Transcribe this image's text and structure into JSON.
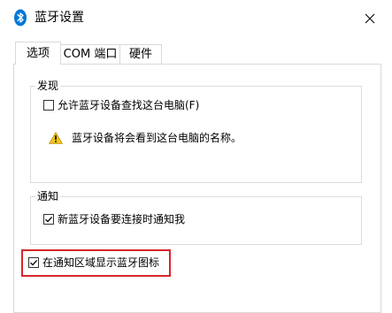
{
  "window": {
    "title": "蓝牙设置",
    "title_icon": "bluetooth-icon",
    "close_icon": "close-icon"
  },
  "tabs": [
    {
      "label": "选项",
      "active": true
    },
    {
      "label": "COM 端口",
      "active": false
    },
    {
      "label": "硬件",
      "active": false
    }
  ],
  "discovery": {
    "legend": "发现",
    "allow_label": "允许蓝牙设备查找这台电脑(F)",
    "allow_checked": false,
    "warning_icon": "warning-icon",
    "warning_text": "蓝牙设备将会看到这台电脑的名称。"
  },
  "notify": {
    "legend": "通知",
    "new_device_label": "新蓝牙设备要连接时通知我",
    "new_device_checked": true
  },
  "tray": {
    "show_icon_label": "在通知区域显示蓝牙图标",
    "show_icon_checked": true
  },
  "colors": {
    "highlight": "#d4262b",
    "bluetooth": "#0078d7",
    "warning": "#f5c518"
  }
}
